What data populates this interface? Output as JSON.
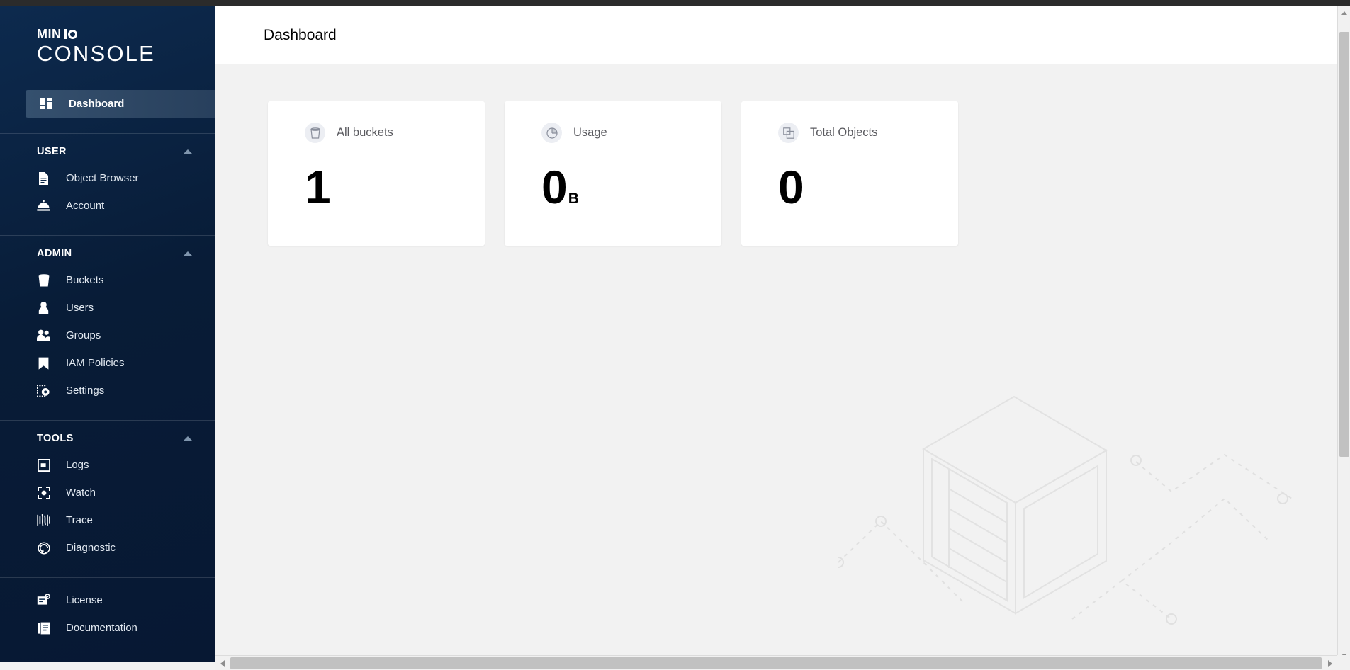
{
  "app": {
    "brand_line1": "MIN",
    "brand_io": "IO",
    "brand_line2": "CONSOLE",
    "sidebar_bg": "#0b2747",
    "active_item_bg": "#334e6c",
    "accent": "#ffffff"
  },
  "header": {
    "title": "Dashboard"
  },
  "sidebar": {
    "active": {
      "label": "Dashboard",
      "icon": "dashboard-icon"
    },
    "sections": [
      {
        "title": "USER",
        "collapse_icon": "chevron-up-icon",
        "items": [
          {
            "label": "Object Browser",
            "icon": "document-icon"
          },
          {
            "label": "Account",
            "icon": "service-bell-icon"
          }
        ]
      },
      {
        "title": "ADMIN",
        "collapse_icon": "chevron-up-icon",
        "items": [
          {
            "label": "Buckets",
            "icon": "bucket-icon"
          },
          {
            "label": "Users",
            "icon": "user-icon"
          },
          {
            "label": "Groups",
            "icon": "users-group-icon"
          },
          {
            "label": "IAM Policies",
            "icon": "bookmark-icon"
          },
          {
            "label": "Settings",
            "icon": "gear-icon"
          }
        ]
      },
      {
        "title": "TOOLS",
        "collapse_icon": "chevron-up-icon",
        "items": [
          {
            "label": "Logs",
            "icon": "window-icon"
          },
          {
            "label": "Watch",
            "icon": "focus-target-icon"
          },
          {
            "label": "Trace",
            "icon": "waveform-icon"
          },
          {
            "label": "Diagnostic",
            "icon": "pulse-spiral-icon"
          }
        ]
      },
      {
        "title": "",
        "collapse_icon": "",
        "items": [
          {
            "label": "License",
            "icon": "license-badge-icon"
          },
          {
            "label": "Documentation",
            "icon": "book-icon"
          }
        ]
      }
    ]
  },
  "main": {
    "cards": [
      {
        "label": "All buckets",
        "icon": "bucket-icon",
        "value": "1",
        "unit": ""
      },
      {
        "label": "Usage",
        "icon": "pie-chart-icon",
        "value": "0",
        "unit": "B"
      },
      {
        "label": "Total Objects",
        "icon": "objects-stack-icon",
        "value": "0",
        "unit": ""
      }
    ],
    "background_illustration": "isometric-server-rack-illustration"
  },
  "scrollbars": {
    "vertical": {
      "up": "scroll-up-arrow",
      "down": "scroll-down-arrow"
    },
    "horizontal": {
      "left": "scroll-left-arrow",
      "right": "scroll-right-arrow"
    }
  }
}
